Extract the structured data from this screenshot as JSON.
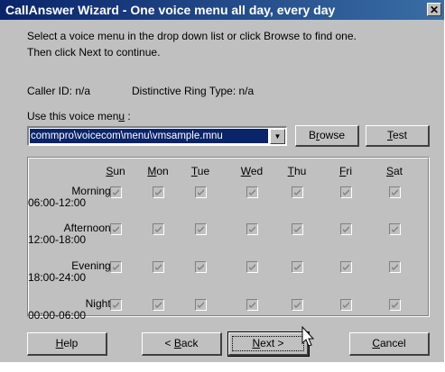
{
  "window": {
    "title": "CallAnswer Wizard - One voice menu all day, every day",
    "close_glyph": "✕"
  },
  "instructions": {
    "line1": "Select a voice menu in the drop down list or click Browse to find one.",
    "line2": "Then click Next to continue."
  },
  "caller_id": "Caller ID: n/a",
  "distinctive_ring": "Distinctive Ring Type: n/a",
  "voice_menu": {
    "label_pre": "Use this voice men",
    "label_accel": "u",
    "label_post": " :",
    "selected": "commpro\\voicecom\\menu\\vmsample.mnu"
  },
  "buttons": {
    "browse": {
      "pre": "B",
      "accel": "r",
      "post": "owse"
    },
    "test": {
      "pre": "",
      "accel": "T",
      "post": "est"
    },
    "help": {
      "pre": "",
      "accel": "H",
      "post": "elp"
    },
    "back": {
      "pre": "< ",
      "accel": "B",
      "post": "ack"
    },
    "next": {
      "pre": "",
      "accel": "N",
      "post": "ext >"
    },
    "cancel": {
      "pre": "",
      "accel": "C",
      "post": "ancel"
    }
  },
  "schedule": {
    "days": [
      {
        "accel": "S",
        "rest": "un"
      },
      {
        "accel": "M",
        "rest": "on"
      },
      {
        "accel": "T",
        "rest": "ue"
      },
      {
        "accel": "W",
        "rest": "ed"
      },
      {
        "accel": "T",
        "rest": "hu"
      },
      {
        "accel": "F",
        "rest": "ri"
      },
      {
        "accel": "S",
        "rest": "at"
      }
    ],
    "slots": [
      {
        "label": "Morning:",
        "time": "06:00-12:00"
      },
      {
        "label": "Afternoon:",
        "time": "12:00-18:00"
      },
      {
        "label": "Evening:",
        "time": "18:00-24:00"
      },
      {
        "label": "Night:",
        "time": "00:00-06:00"
      }
    ],
    "checked": true,
    "disabled": true
  }
}
